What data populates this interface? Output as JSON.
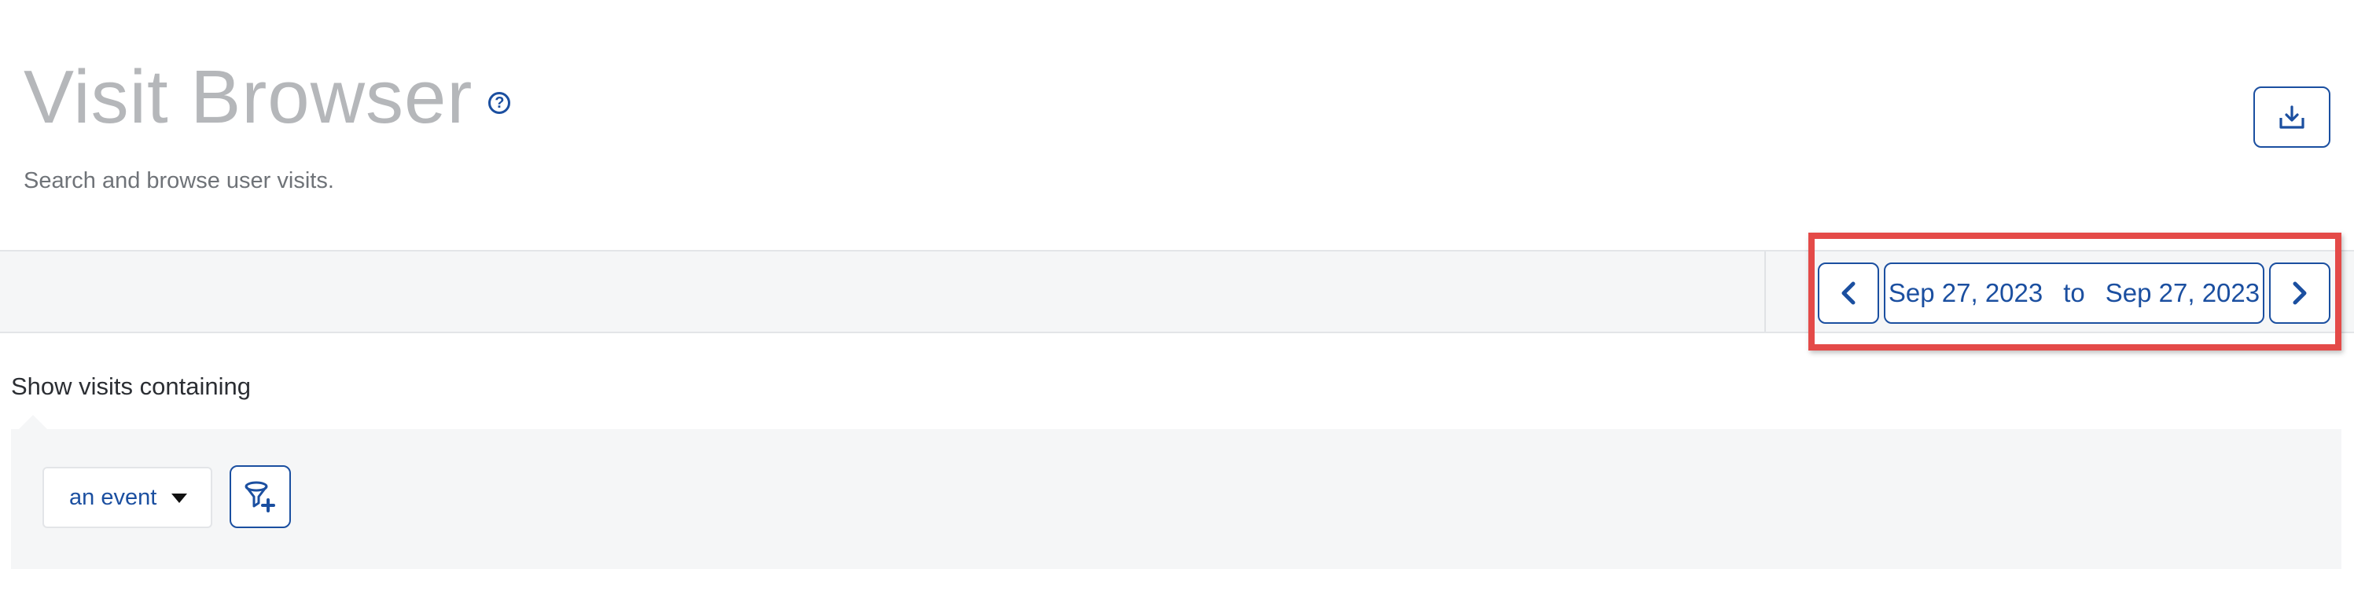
{
  "header": {
    "title": "Visit Browser",
    "help_glyph": "?",
    "subtitle": "Search and browse user visits."
  },
  "toolbar": {
    "export_icon": "download-tray-icon",
    "date_range": {
      "start": "Sep 27, 2023",
      "separator": "to",
      "end": "Sep 27, 2023"
    },
    "prev_icon": "chevron-left-icon",
    "next_icon": "chevron-right-icon"
  },
  "filters": {
    "label": "Show visits containing",
    "type_select_value": "an event",
    "add_filter_icon": "filter-plus-icon"
  },
  "colors": {
    "accent": "#1b4fa0",
    "title_gray": "#b5b7ba",
    "panel_bg": "#f5f6f7",
    "highlight_red": "#e44a48"
  }
}
